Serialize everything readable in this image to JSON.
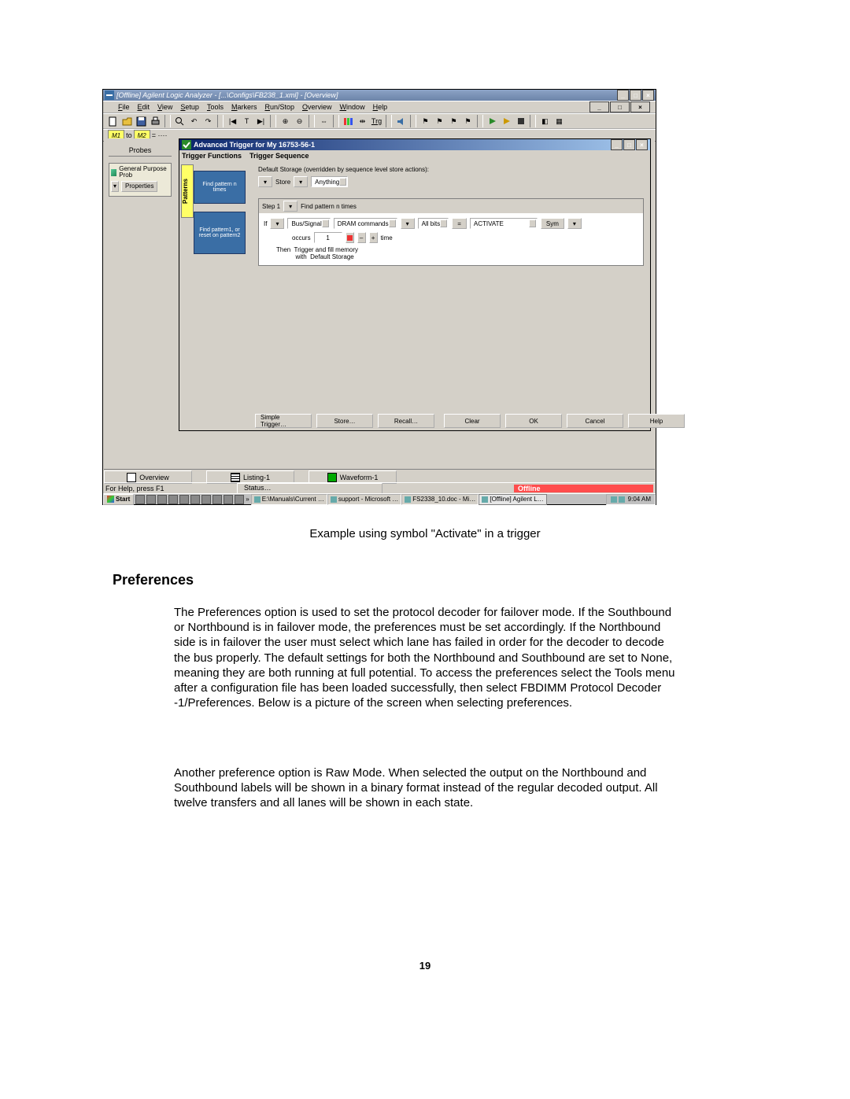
{
  "app": {
    "outer_title": "[Offline] Agilent Logic Analyzer  - [...\\Configs\\FB238_1.xml] - [Overview]",
    "menu": [
      "File",
      "Edit",
      "View",
      "Setup",
      "Tools",
      "Markers",
      "Run/Stop",
      "Overview",
      "Window",
      "Help"
    ],
    "marker_bar": {
      "m1": "M1",
      "to": "to",
      "m2": "M2",
      "eq": "= ····"
    },
    "toolbar_icons": [
      "new",
      "open",
      "save",
      "print",
      "find",
      "find-next",
      "find-prev",
      "first",
      "pause",
      "last",
      "zoom-in",
      "zoom-out",
      "scale-full",
      "go-to-trigger",
      "center",
      "trigger-pos",
      "speaker",
      "flag1",
      "flag2",
      "flag3",
      "flag4",
      "run",
      "run-rep",
      "stop",
      "overlay",
      "group"
    ]
  },
  "probes": {
    "header": "Probes",
    "module_name": "General Purpose Prob",
    "properties_btn": "Properties"
  },
  "dialog": {
    "title": "Advanced Trigger for My 16753-56-1",
    "col_functions": "Trigger Functions",
    "col_sequence": "Trigger Sequence",
    "patterns_tab": "Patterns",
    "func_find_pattern": "Find pattern n times",
    "func_find_reset": "Find pattern1, or reset on pattern2",
    "default_storage": "Default Storage (overridden by sequence level store actions):",
    "store_label": "Store",
    "store_value": "Anything",
    "step_label": "Step 1",
    "step_desc": "Find pattern n times",
    "if": "If",
    "bus_signal": "Bus/Signal",
    "dram": "DRAM commands",
    "allbits": "All bits",
    "eq": "=",
    "activate": "ACTIVATE",
    "sym": "Sym",
    "occurs": "occurs",
    "occurs_n": "1",
    "time": "time",
    "then": "Then  Trigger and fill memory\n           with  Default Storage",
    "buttons": [
      "Simple Trigger…",
      "Store…",
      "Recall…",
      "Clear",
      "OK",
      "Cancel",
      "Help"
    ]
  },
  "bottom_tabs": [
    {
      "icon": "overview",
      "label": "Overview"
    },
    {
      "icon": "listing",
      "label": "Listing-1"
    },
    {
      "icon": "waveform",
      "label": "Waveform-1"
    }
  ],
  "statusbar": {
    "help": "For Help, press F1",
    "status_btn": "Status…",
    "offline": "Offline"
  },
  "taskbar": {
    "start": "Start",
    "tasks": [
      "E:\\Manuals\\Current …",
      "support - Microsoft …",
      "FS2338_10.doc - Mi…",
      "[Offline] Agilent L…"
    ],
    "clock": "9:04 AM"
  },
  "doc": {
    "caption": "Example using symbol \"Activate\" in a trigger",
    "heading": "Preferences",
    "para1": "The Preferences option is used to set the protocol decoder for failover mode.  If the Southbound or Northbound is in failover mode, the preferences must be set accordingly.  If the Northbound side is in failover the user must select which lane has failed in order for the decoder to decode the bus properly.  The default settings for both the Northbound and Southbound are set to None, meaning they are both running at full potential.  To access the preferences select the Tools menu after a configuration file has been loaded successfully, then select FBDIMM Protocol Decoder -1/Preferences.  Below is a picture of the screen when selecting preferences.",
    "para2": "Another preference option is Raw Mode.  When selected the output on the Northbound and Southbound labels will be shown in a binary format instead of the regular decoded output.  All twelve transfers and all lanes will be shown in each state.",
    "pagenum": "19"
  }
}
